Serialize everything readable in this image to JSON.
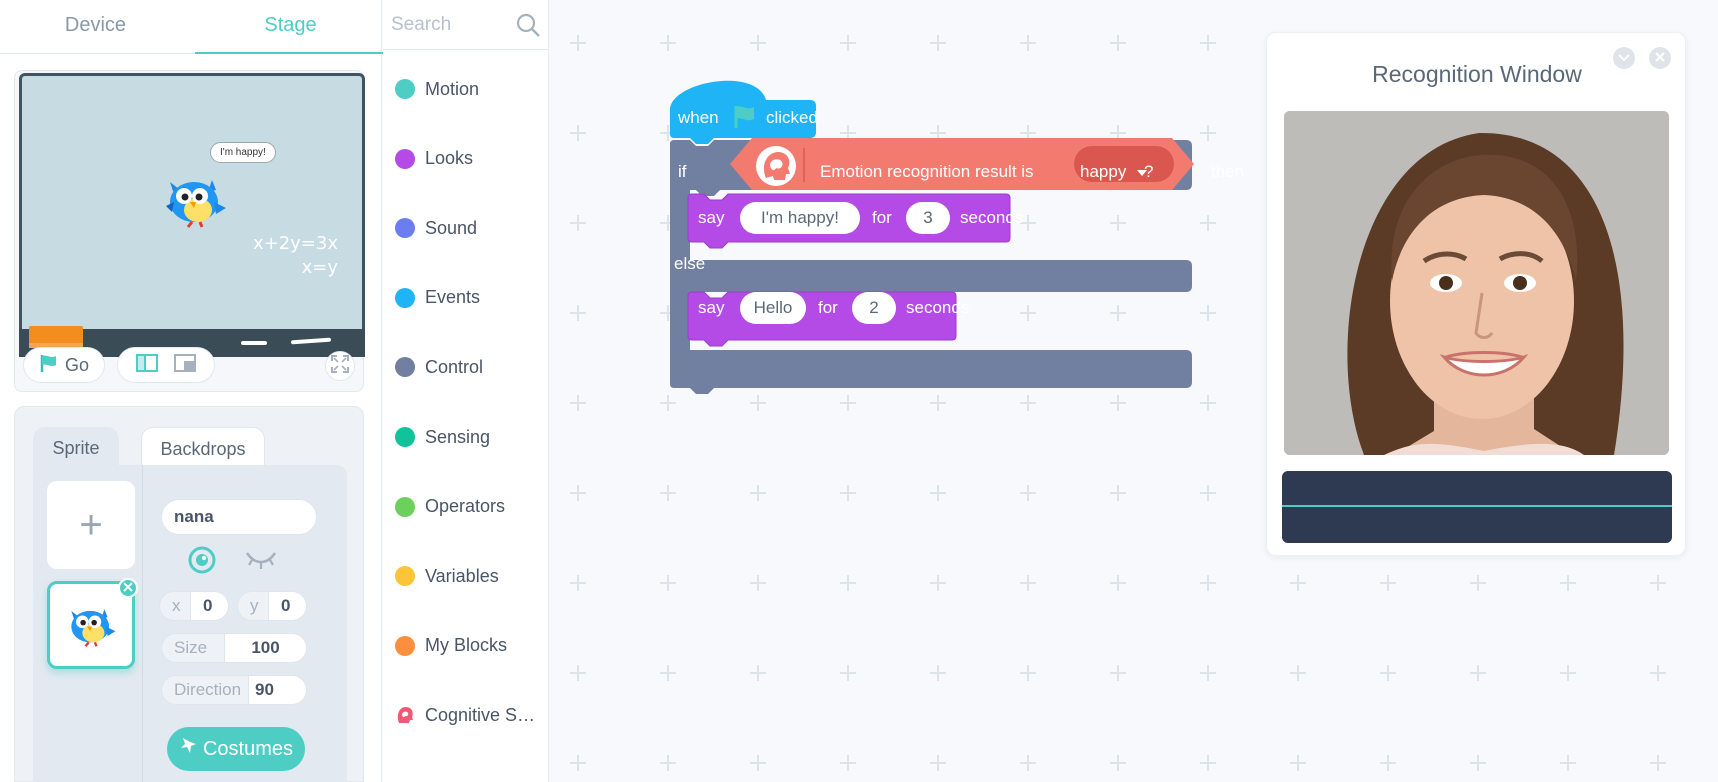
{
  "top_tabs": {
    "device": "Device",
    "stage": "Stage"
  },
  "stage": {
    "speech_bubble": "I'm happy!",
    "math_line1": "x+2y=3x",
    "math_line2": "x=y",
    "go_label": "Go"
  },
  "sprite_panel": {
    "tab_sprite": "Sprite",
    "tab_backdrops": "Backdrops",
    "add_symbol": "+",
    "name": "nana",
    "x_label": "x",
    "x_value": "0",
    "y_label": "y",
    "y_value": "0",
    "size_label": "Size",
    "size_value": "100",
    "direction_label": "Direction",
    "direction_value": "90",
    "costumes_label": "Costumes"
  },
  "search": {
    "placeholder": "Search"
  },
  "categories": [
    {
      "label": "Motion",
      "color": "#4ecdc4"
    },
    {
      "label": "Looks",
      "color": "#b44be6"
    },
    {
      "label": "Sound",
      "color": "#6c7df0"
    },
    {
      "label": "Events",
      "color": "#1fb4f5"
    },
    {
      "label": "Control",
      "color": "#7180a0"
    },
    {
      "label": "Sensing",
      "color": "#12c29a"
    },
    {
      "label": "Operators",
      "color": "#6cd15c"
    },
    {
      "label": "Variables",
      "color": "#fcc537"
    },
    {
      "label": "My Blocks",
      "color": "#fb8f3e"
    },
    {
      "label": "Cognitive S…",
      "color": "#f05a76"
    }
  ],
  "blocks": {
    "hat_when": "when",
    "hat_clicked": "clicked",
    "if_label": "if",
    "condition_text": "Emotion recognition result is",
    "emotion_value": "happy",
    "question_mark": "?",
    "then_label": "then",
    "say1_label": "say",
    "say1_text": "I'm happy!",
    "say1_for": "for",
    "say1_secs": "3",
    "say1_seconds": "seconds",
    "else_label": "else",
    "say2_label": "say",
    "say2_text": "Hello",
    "say2_for": "for",
    "say2_secs": "2",
    "say2_seconds": "seconds"
  },
  "recognition_window": {
    "title": "Recognition Window"
  },
  "colors": {
    "accent": "#4ecdc4",
    "events": "#1fb4f5",
    "control": "#7180a0",
    "looks": "#b44be6",
    "cognitive": "#f27a6e",
    "result_bar": "#2d3a52"
  }
}
